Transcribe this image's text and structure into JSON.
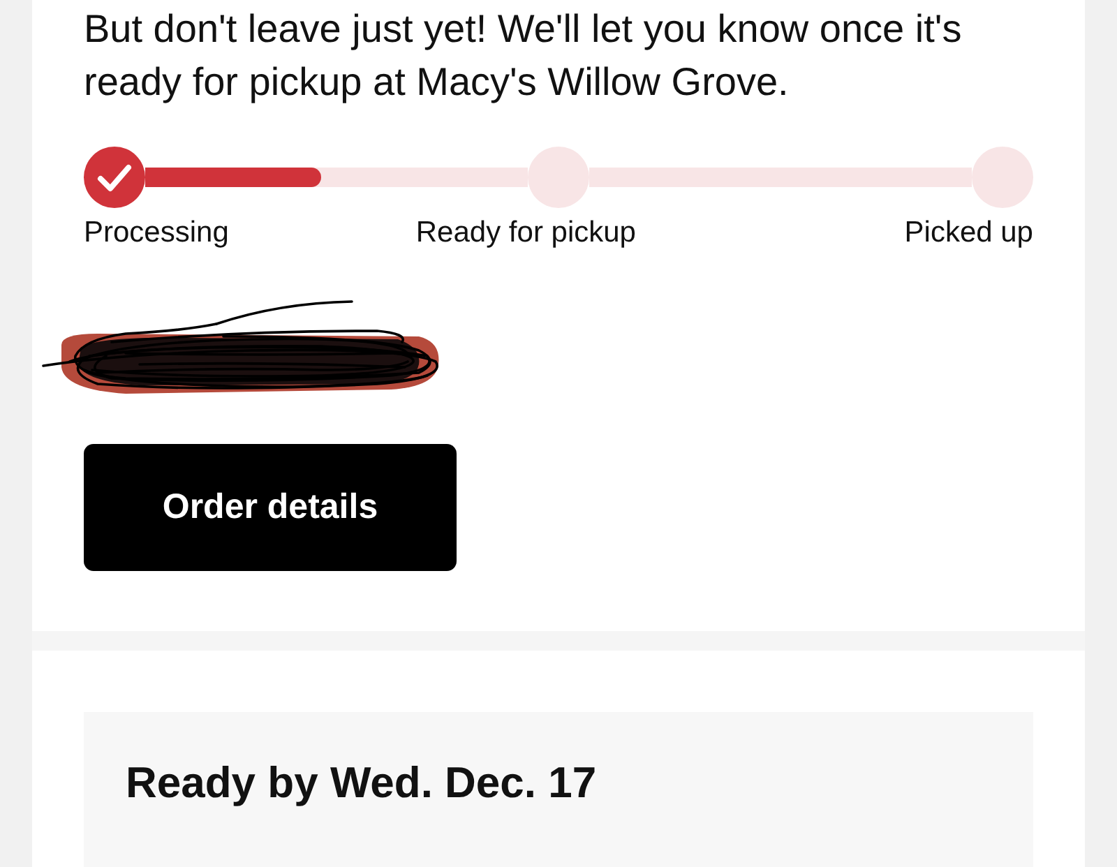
{
  "message": "But don't leave just yet! We'll let you know once it's ready for pickup at Macy's Willow Grove.",
  "progress": {
    "steps": [
      {
        "label": "Processing",
        "done": true
      },
      {
        "label": "Ready for pickup",
        "done": false
      },
      {
        "label": "Picked up",
        "done": false
      }
    ],
    "connectors": [
      {
        "level": 0.46
      }
    ]
  },
  "order_details_button": "Order details",
  "pickup_card": {
    "title": "Ready by Wed. Dec. 17"
  }
}
